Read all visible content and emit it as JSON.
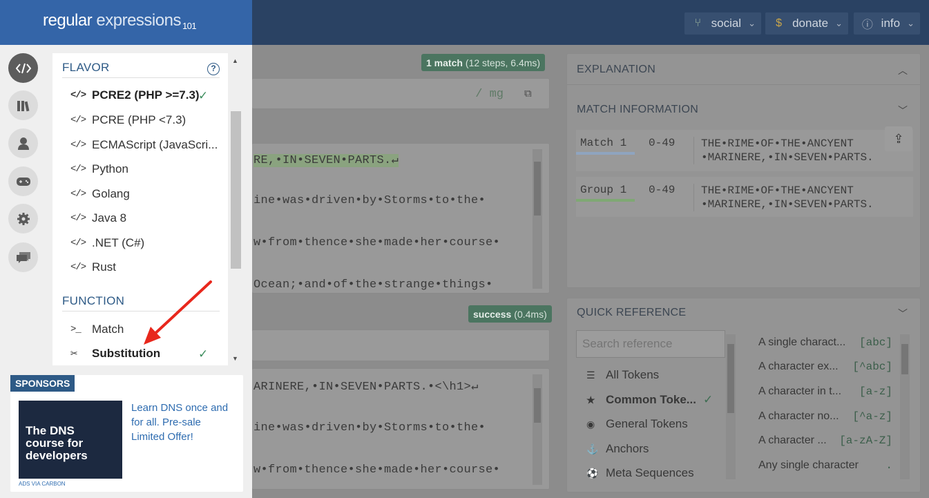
{
  "header": {
    "logo_main": "regular",
    "logo_light": "expressions",
    "logo_sub": "101",
    "buttons": [
      {
        "label": "social",
        "icon": "branch-icon"
      },
      {
        "label": "donate",
        "icon": "dollar-icon"
      },
      {
        "label": "info",
        "icon": "info-icon"
      }
    ]
  },
  "regex": {
    "match_status_bold": "1 match",
    "match_status_detail": "(12 steps, 6.4ms)",
    "flags": "/ mg"
  },
  "test_string": {
    "lines": [
      "RE,•IN•SEVEN•PARTS.↵",
      "ine•was•driven•by•Storms•to•the•",
      "w•from•thence•she•made•her•course•",
      "Ocean;•and•of•the•strange•things•"
    ]
  },
  "substitution": {
    "status_bold": "success",
    "status_detail": "(0.4ms)",
    "result_lines": [
      "ARINERE,•IN•SEVEN•PARTS.•<\\h1>↵",
      "ine•was•driven•by•Storms•to•the•",
      "w•from•thence•she•made•her•course•"
    ]
  },
  "explanation": {
    "title": "EXPLANATION",
    "match_info_title": "MATCH INFORMATION",
    "rows": [
      {
        "label": "Match 1",
        "range": "0-49",
        "text_1": "THE•RIME•OF•THE•ANCYENT",
        "text_2": "•MARINERE,•IN•SEVEN•PARTS.",
        "underline": "#8fa4bf"
      },
      {
        "label": "Group 1",
        "range": "0-49",
        "text_1": "THE•RIME•OF•THE•ANCYENT",
        "text_2": "•MARINERE,•IN•SEVEN•PARTS.",
        "underline": "#7fa874"
      }
    ]
  },
  "quick_reference": {
    "title": "QUICK REFERENCE",
    "search_placeholder": "Search reference",
    "categories": [
      {
        "label": "All Tokens",
        "icon": "stack-icon"
      },
      {
        "label": "Common Toke...",
        "icon": "star-icon",
        "selected": true
      },
      {
        "label": "General Tokens",
        "icon": "target-icon"
      },
      {
        "label": "Anchors",
        "icon": "anchor-icon"
      },
      {
        "label": "Meta Sequences",
        "icon": "soccer-ball-icon"
      }
    ],
    "tokens": [
      {
        "desc": "A single charact...",
        "token": "[abc]"
      },
      {
        "desc": "A character ex...",
        "token": "[^abc]"
      },
      {
        "desc": "A character in t...",
        "token": "[a-z]"
      },
      {
        "desc": "A character no...",
        "token": "[^a-z]"
      },
      {
        "desc": "A character ...",
        "token": "[a-zA-Z]"
      },
      {
        "desc": "Any single character",
        "token": "."
      }
    ]
  },
  "sidebar": {
    "nav_icons": [
      "code-icon",
      "library-icon",
      "user-icon",
      "gamepad-icon",
      "settings-gear-icon",
      "chat-icon"
    ],
    "flavor_heading": "FLAVOR",
    "flavors": [
      {
        "label": "PCRE2 (PHP >=7.3)",
        "selected": true
      },
      {
        "label": "PCRE (PHP <7.3)"
      },
      {
        "label": "ECMAScript (JavaScri..."
      },
      {
        "label": "Python"
      },
      {
        "label": "Golang"
      },
      {
        "label": "Java 8"
      },
      {
        "label": ".NET (C#)"
      },
      {
        "label": "Rust"
      }
    ],
    "function_heading": "FUNCTION",
    "functions": [
      {
        "label": "Match",
        "icon": "terminal-prompt-icon"
      },
      {
        "label": "Substitution",
        "icon": "scissors-icon",
        "selected": true
      }
    ]
  },
  "sponsors": {
    "badge": "SPONSORS",
    "image_text": "The DNS course for developers",
    "ad_text": "Learn DNS once and for all. Pre-sale Limited Offer!",
    "via": "ADS VIA CARBON"
  },
  "colors": {
    "brand_blue": "#3465a8",
    "check_green": "#3e8e5e",
    "annotation_red": "#e8271c"
  }
}
